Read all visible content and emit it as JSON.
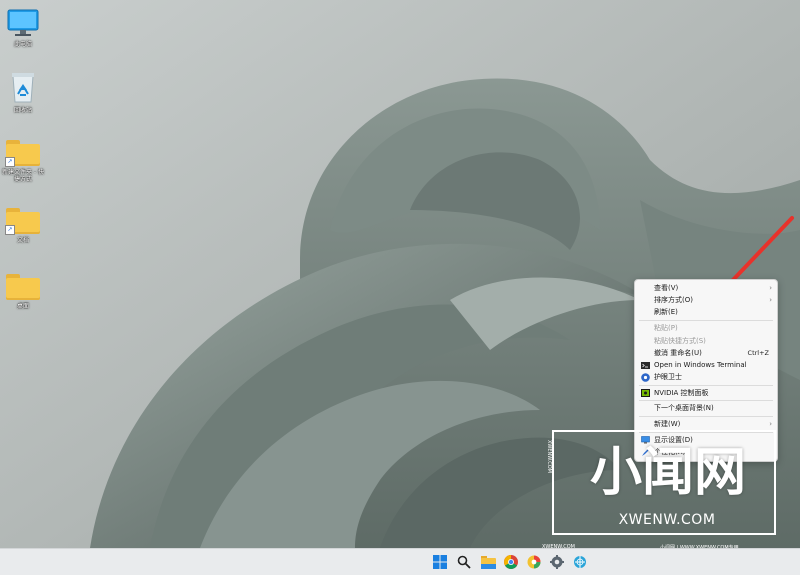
{
  "desktop": {
    "icons": [
      {
        "label": "此电脑",
        "icon": "computer-icon"
      },
      {
        "label": "回收站",
        "icon": "recycle-bin-icon"
      },
      {
        "label": "新建文件夹 - 快捷方式",
        "icon": "folder-shortcut-icon"
      },
      {
        "label": "文档",
        "icon": "folder-shortcut-icon"
      },
      {
        "label": "桌面",
        "icon": "folder-icon"
      }
    ]
  },
  "context_menu": {
    "items": [
      {
        "label": "查看(V)",
        "has_submenu": true
      },
      {
        "label": "排序方式(O)",
        "has_submenu": true
      },
      {
        "label": "刷新(E)"
      },
      {
        "label": "粘贴(P)",
        "disabled": true
      },
      {
        "label": "粘贴快捷方式(S)",
        "disabled": true
      },
      {
        "label": "撤消 重命名(U)",
        "shortcut": "Ctrl+Z"
      },
      {
        "label": "Open in Windows Terminal",
        "icon": "terminal-icon"
      },
      {
        "label": "护眼卫士",
        "icon": "eye-care-icon"
      },
      {
        "label": "NVIDIA 控制面板",
        "icon": "nvidia-icon"
      },
      {
        "label": "下一个桌面背景(N)"
      },
      {
        "label": "新建(W)",
        "has_submenu": true
      },
      {
        "label": "显示设置(D)",
        "icon": "display-icon"
      },
      {
        "label": "个性化(R)",
        "icon": "personalize-icon"
      }
    ]
  },
  "watermark": {
    "big_text": "小闻网",
    "url": "XWENW.COM",
    "side_text": "XWENW.COM",
    "foot_left": "XWENW.COM",
    "foot_right": "小闻网 | WWW.XWENW.COM专用"
  },
  "taskbar": {
    "icons": [
      "start-icon",
      "search-icon",
      "file-explorer-icon",
      "chrome-icon",
      "color-app-icon",
      "settings-icon",
      "network-app-icon"
    ]
  },
  "colors": {
    "arrow": "#e8322b",
    "taskbar": "#e9ebed",
    "menu_bg": "#f7f7f7"
  }
}
